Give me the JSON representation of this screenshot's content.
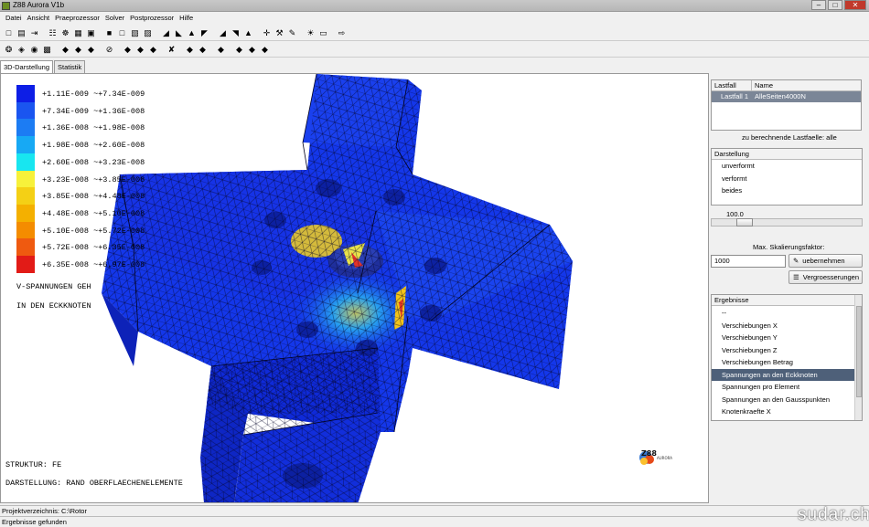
{
  "window": {
    "title": "Z88 Aurora V1b"
  },
  "menu": [
    "Datei",
    "Ansicht",
    "Praeprozessor",
    "Solver",
    "Postprozessor",
    "Hilfe"
  ],
  "toolbar1": [
    {
      "icon": "new-file-icon",
      "glyph": "□"
    },
    {
      "icon": "open-folder-icon",
      "glyph": "▤"
    },
    {
      "icon": "import-icon",
      "glyph": "⇥"
    },
    {
      "icon": "mesh-icon",
      "glyph": "☷"
    },
    {
      "icon": "mesh-refine-icon",
      "glyph": "☸"
    },
    {
      "icon": "grid-icon",
      "glyph": "▦"
    },
    {
      "icon": "material-icon",
      "glyph": "▣"
    },
    {
      "icon": "cube-solid-icon",
      "glyph": "■"
    },
    {
      "icon": "cube-wire-icon",
      "glyph": "□"
    },
    {
      "icon": "cube-face-icon",
      "glyph": "▧"
    },
    {
      "icon": "cube-transparent-icon",
      "glyph": "▨"
    },
    {
      "icon": "boundary-icon",
      "glyph": "◢"
    },
    {
      "icon": "load-icon",
      "glyph": "◣"
    },
    {
      "icon": "support-icon",
      "glyph": "▲"
    },
    {
      "icon": "constraint-icon",
      "glyph": "◤"
    },
    {
      "icon": "solver-icon",
      "glyph": "◢"
    },
    {
      "icon": "solve-run-icon",
      "glyph": "◥"
    },
    {
      "icon": "result-icon",
      "glyph": "▲"
    },
    {
      "icon": "pan-icon",
      "glyph": "✛"
    },
    {
      "icon": "tools-icon",
      "glyph": "⚒"
    },
    {
      "icon": "brush-icon",
      "glyph": "✎"
    },
    {
      "icon": "light-icon",
      "glyph": "☀"
    },
    {
      "icon": "label-icon",
      "glyph": "▭"
    },
    {
      "icon": "exit-icon",
      "glyph": "⇨"
    }
  ],
  "toolbar2": [
    {
      "icon": "select-icon",
      "glyph": "❂"
    },
    {
      "icon": "material-db-icon",
      "glyph": "◈"
    },
    {
      "icon": "element-icon",
      "glyph": "◉"
    },
    {
      "icon": "save-icon",
      "glyph": "▩"
    },
    {
      "icon": "node-icon",
      "glyph": "◆"
    },
    {
      "icon": "element-red-icon",
      "glyph": "◆"
    },
    {
      "icon": "element-blue-icon",
      "glyph": "◆"
    },
    {
      "icon": "delete-icon",
      "glyph": "⊘"
    },
    {
      "icon": "force-icon",
      "glyph": "◆"
    },
    {
      "icon": "force-x-icon",
      "glyph": "◆"
    },
    {
      "icon": "force-y-icon",
      "glyph": "◆"
    },
    {
      "icon": "displacement-icon",
      "glyph": "✘"
    },
    {
      "icon": "mesh-green-icon",
      "glyph": "◆"
    },
    {
      "icon": "mesh-red-icon",
      "glyph": "◆"
    },
    {
      "icon": "mesh-blue-icon",
      "glyph": "◆"
    },
    {
      "icon": "stress-icon",
      "glyph": "◆"
    },
    {
      "icon": "stress-nodes-icon",
      "glyph": "◆"
    },
    {
      "icon": "stress-elements-icon",
      "glyph": "◆"
    }
  ],
  "tabs": [
    "3D-Darstellung",
    "Statistik"
  ],
  "legend": {
    "colors": [
      "#0d1ee6",
      "#1a55f0",
      "#1c7cf3",
      "#17a9f4",
      "#18e6f0",
      "#f7f13a",
      "#f4d015",
      "#f4b000",
      "#f48c00",
      "#ef5a10",
      "#e21b17"
    ],
    "labels": [
      "+1.11E-009 ~+7.34E-009",
      "+7.34E-009 ~+1.36E-008",
      "+1.36E-008 ~+1.98E-008",
      "+1.98E-008 ~+2.60E-008",
      "+2.60E-008 ~+3.23E-008",
      "+3.23E-008 ~+3.85E-008",
      "+3.85E-008 ~+4.48E-008",
      "+4.48E-008 ~+5.10E-008",
      "+5.10E-008 ~+5.72E-008",
      "+5.72E-008 ~+6.35E-008",
      "+6.35E-008 ~+6.97E-008"
    ]
  },
  "view_text": {
    "line1": "V-SPANNUNGEN GEH",
    "line2": "IN DEN ECKKNOTEN",
    "struktur": "STRUKTUR: FE",
    "darstellung": "DARSTELLUNG: RAND OBERFLAECHENELEMENTE",
    "logo": "Z88",
    "logo_sub": "AURORA"
  },
  "panel": {
    "loadcase_header": {
      "col1": "Lastfall",
      "col2": "Name"
    },
    "loadcase_row": {
      "col1": "Lastfall 1",
      "col2": "AlleSeiten4000N"
    },
    "compute_label": "zu berechnende Lastfaelle: alle",
    "darstellung_header": "Darstellung",
    "darstellung_items": [
      "unverformt",
      "verformt",
      "beides"
    ],
    "slider_value": "100.0",
    "slider_fraction": 0.18,
    "scale_label": "Max. Skalierungsfaktor:",
    "scale_value": "1000",
    "apply_button": "uebernehmen",
    "magnify_button": "Vergroesserungen",
    "ergebnisse_header": "Ergebnisse",
    "ergebnisse_items": [
      "--",
      "Verschiebungen X",
      "Verschiebungen Y",
      "Verschiebungen Z",
      "Verschiebungen Betrag",
      "Spannungen an den Eckknoten",
      "Spannungen pro Element",
      "Spannungen an den Gausspunkten",
      "Knotenkraefte X"
    ],
    "ergebnisse_selected": 5
  },
  "status": {
    "line1": "Projektverzeichnis: C:\\Rotor",
    "line2": "Ergebnisse gefunden"
  },
  "watermark": "sudar.ch"
}
